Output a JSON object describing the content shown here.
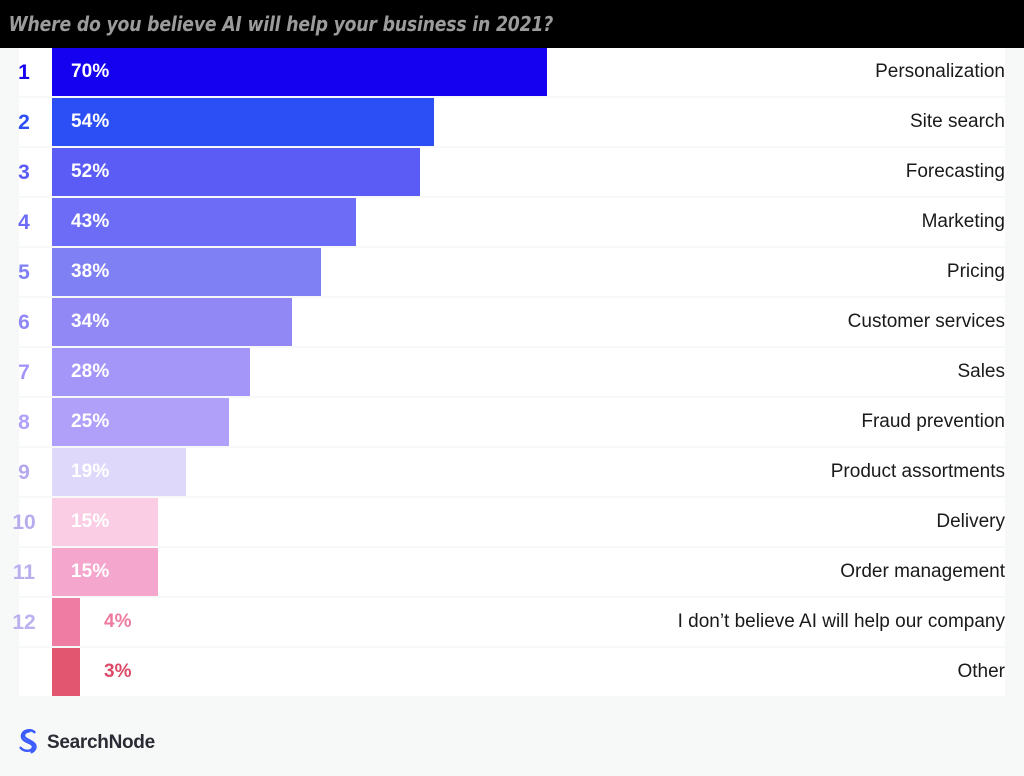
{
  "header": {
    "title": "Where do you believe AI will help your business in 2021?"
  },
  "footer": {
    "logo_mark": "searchnode-s-logo",
    "logo_text": "SearchNode",
    "logo_color": "#3b5bfd"
  },
  "colors": {
    "page_background": "#f7f8f8",
    "header_background": "#000000",
    "header_text": "#9b9b9b",
    "row_background": "#ffffff",
    "label_text": "#1a1a1a",
    "bar_value_inside": "#ffffff"
  },
  "chart_data": {
    "type": "bar",
    "orientation": "horizontal",
    "title": "Where do you believe AI will help your business in 2021?",
    "xlabel": "",
    "ylabel": "",
    "xlim": [
      0,
      100
    ],
    "grid": false,
    "legend": null,
    "value_suffix": "%",
    "categories": [
      "Personalization",
      "Site search",
      "Forecasting",
      "Marketing",
      "Pricing",
      "Customer services",
      "Sales",
      "Fraud prevention",
      "Product assortments",
      "Delivery",
      "Order management",
      "I don’t believe AI will help our company",
      "Other"
    ],
    "values": [
      70,
      54,
      52,
      43,
      38,
      34,
      28,
      25,
      19,
      15,
      15,
      4,
      3
    ],
    "ranks": [
      "1",
      "2",
      "3",
      "4",
      "5",
      "6",
      "7",
      "8",
      "9",
      "10",
      "11",
      "12",
      ""
    ],
    "bar_colors": [
      "#1500f0",
      "#2b4ef5",
      "#5b5bf5",
      "#6c6cf7",
      "#8080f5",
      "#9188f6",
      "#a495f8",
      "#b0a0fa",
      "#ded9fa",
      "#fbcde4",
      "#f4a6cc",
      "#ef7ca2",
      "#e2566f"
    ],
    "rank_colors": [
      "#1500f0",
      "#2b4ef5",
      "#5b5bf5",
      "#6c6cf7",
      "#8080f5",
      "#9188f6",
      "#a495f8",
      "#b0a0fa",
      "#b5a8ee",
      "#b7adee",
      "#b9afee",
      "#bbb1ef",
      "#bbb1ef"
    ],
    "rows": [
      {
        "rank": "1",
        "label": "Personalization",
        "value": 70,
        "value_label": "70%",
        "bar_color": "#1500f0",
        "rank_color": "#1500f0",
        "label_inside": true,
        "label_color": "#ffffff"
      },
      {
        "rank": "2",
        "label": "Site search",
        "value": 54,
        "value_label": "54%",
        "bar_color": "#2b4ef5",
        "rank_color": "#2b4ef5",
        "label_inside": true,
        "label_color": "#ffffff"
      },
      {
        "rank": "3",
        "label": "Forecasting",
        "value": 52,
        "value_label": "52%",
        "bar_color": "#5b5bf5",
        "rank_color": "#5b5bf5",
        "label_inside": true,
        "label_color": "#ffffff"
      },
      {
        "rank": "4",
        "label": "Marketing",
        "value": 43,
        "value_label": "43%",
        "bar_color": "#6c6cf7",
        "rank_color": "#6c6cf7",
        "label_inside": true,
        "label_color": "#ffffff"
      },
      {
        "rank": "5",
        "label": "Pricing",
        "value": 38,
        "value_label": "38%",
        "bar_color": "#8080f5",
        "rank_color": "#8080f5",
        "label_inside": true,
        "label_color": "#ffffff"
      },
      {
        "rank": "6",
        "label": "Customer services",
        "value": 34,
        "value_label": "34%",
        "bar_color": "#9188f6",
        "rank_color": "#9188f6",
        "label_inside": true,
        "label_color": "#ffffff"
      },
      {
        "rank": "7",
        "label": "Sales",
        "value": 28,
        "value_label": "28%",
        "bar_color": "#a495f8",
        "rank_color": "#a495f8",
        "label_inside": true,
        "label_color": "#ffffff"
      },
      {
        "rank": "8",
        "label": "Fraud prevention",
        "value": 25,
        "value_label": "25%",
        "bar_color": "#b0a0fa",
        "rank_color": "#b0a0fa",
        "label_inside": true,
        "label_color": "#ffffff"
      },
      {
        "rank": "9",
        "label": "Product assortments",
        "value": 19,
        "value_label": "19%",
        "bar_color": "#ded9fa",
        "rank_color": "#b5a8ee",
        "label_inside": true,
        "label_color": "#ffffff"
      },
      {
        "rank": "10",
        "label": "Delivery",
        "value": 15,
        "value_label": "15%",
        "bar_color": "#fbcde4",
        "rank_color": "#b7adee",
        "label_inside": true,
        "label_color": "#ffffff"
      },
      {
        "rank": "11",
        "label": "Order management",
        "value": 15,
        "value_label": "15%",
        "bar_color": "#f4a6cc",
        "rank_color": "#b9afee",
        "label_inside": true,
        "label_color": "#ffffff"
      },
      {
        "rank": "12",
        "label": "I don’t believe AI will help our company",
        "value": 4,
        "value_label": "4%",
        "bar_color": "#ef7ca2",
        "rank_color": "#bbb1ef",
        "label_inside": false,
        "label_color": "#ee7b9f"
      },
      {
        "rank": "",
        "label": "Other",
        "value": 3,
        "value_label": "3%",
        "bar_color": "#e2566f",
        "rank_color": "#bbb1ef",
        "label_inside": false,
        "label_color": "#dd4a67"
      }
    ]
  }
}
